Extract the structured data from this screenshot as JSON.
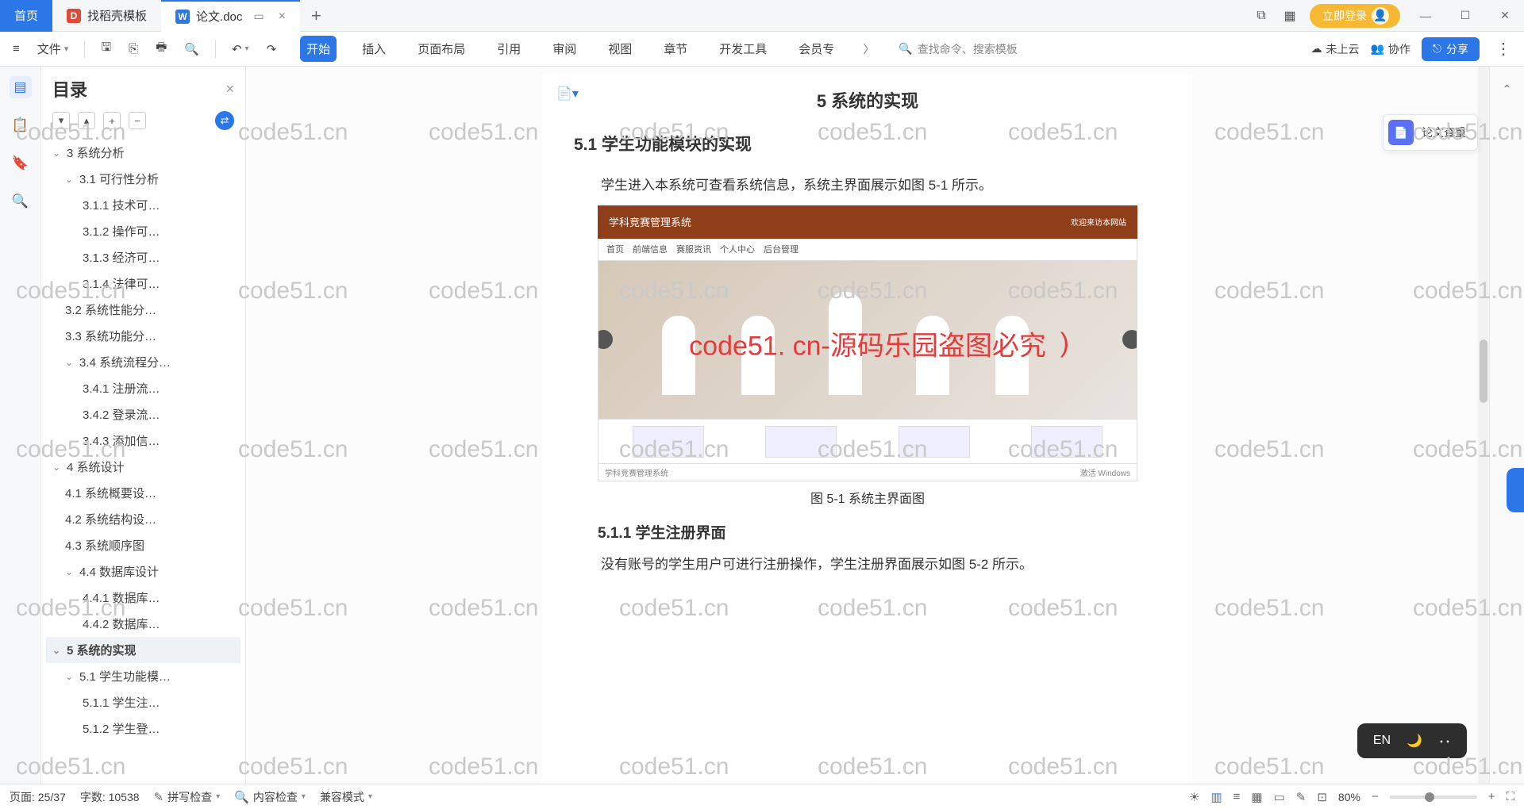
{
  "titlebar": {
    "home_tab": "首页",
    "template_tab": "找稻壳模板",
    "doc_tab": "论文.doc",
    "login": "立即登录"
  },
  "ribbon": {
    "file": "文件",
    "tabs": [
      "开始",
      "插入",
      "页面布局",
      "引用",
      "审阅",
      "视图",
      "章节",
      "开发工具",
      "会员专"
    ],
    "search_ph": "查找命令、搜索模板",
    "cloud": "未上云",
    "coop": "协作",
    "share": "分享"
  },
  "outline": {
    "title": "目录",
    "items": [
      {
        "lvl": 0,
        "chev": "v",
        "text": "3 系统分析"
      },
      {
        "lvl": 1,
        "chev": "v",
        "text": "3.1 可行性分析"
      },
      {
        "lvl": 2,
        "text": "3.1.1 技术可…"
      },
      {
        "lvl": 2,
        "text": "3.1.2 操作可…"
      },
      {
        "lvl": 2,
        "text": "3.1.3 经济可…"
      },
      {
        "lvl": 2,
        "text": "3.1.4 法律可…"
      },
      {
        "lvl": 1,
        "text": "3.2 系统性能分…"
      },
      {
        "lvl": 1,
        "text": "3.3 系统功能分…"
      },
      {
        "lvl": 1,
        "chev": "v",
        "text": "3.4 系统流程分…"
      },
      {
        "lvl": 2,
        "text": "3.4.1 注册流…"
      },
      {
        "lvl": 2,
        "text": "3.4.2 登录流…"
      },
      {
        "lvl": 2,
        "text": "3.4.3 添加信…"
      },
      {
        "lvl": 0,
        "chev": "v",
        "text": "4 系统设计"
      },
      {
        "lvl": 1,
        "text": "4.1 系统概要设…"
      },
      {
        "lvl": 1,
        "text": "4.2 系统结构设…"
      },
      {
        "lvl": 1,
        "text": "4.3 系统顺序图"
      },
      {
        "lvl": 1,
        "chev": "v",
        "text": "4.4 数据库设计"
      },
      {
        "lvl": 2,
        "text": "4.4.1 数据库…"
      },
      {
        "lvl": 2,
        "text": "4.4.2 数据库…"
      },
      {
        "lvl": 0,
        "chev": "v",
        "text": "5 系统的实现",
        "sel": true
      },
      {
        "lvl": 1,
        "chev": "v",
        "text": "5.1 学生功能模…"
      },
      {
        "lvl": 2,
        "text": "5.1.1 学生注…"
      },
      {
        "lvl": 2,
        "text": "5.1.2 学生登…"
      }
    ]
  },
  "doc": {
    "h5": "5 系统的实现",
    "h51": "5.1 学生功能模块的实现",
    "p1": "学生进入本系统可查看系统信息，系统主界面展示如图 5-1 所示。",
    "fig_banner": "学科竞赛管理系统",
    "fig_banner_right": "欢迎来访本网站",
    "fig_nav": "首页　前端信息　赛服资讯　个人中心　后台管理",
    "fig_caption": "图 5-1 系统主界面图",
    "h511": "5.1.1  学生注册界面",
    "p2": "没有账号的学生用户可进行注册操作，学生注册界面展示如图 5-2 所示。",
    "wm_red": "code51. cn-源码乐园盗图必究",
    "wm_paren": ")"
  },
  "watermark": "code51.cn",
  "right_float": "论文查重",
  "ime": {
    "lang": "EN"
  },
  "status": {
    "page": "页面: 25/37",
    "words": "字数: 10538",
    "spell": "拼写检查",
    "content": "内容检查",
    "compat": "兼容模式",
    "zoom": "80%"
  }
}
